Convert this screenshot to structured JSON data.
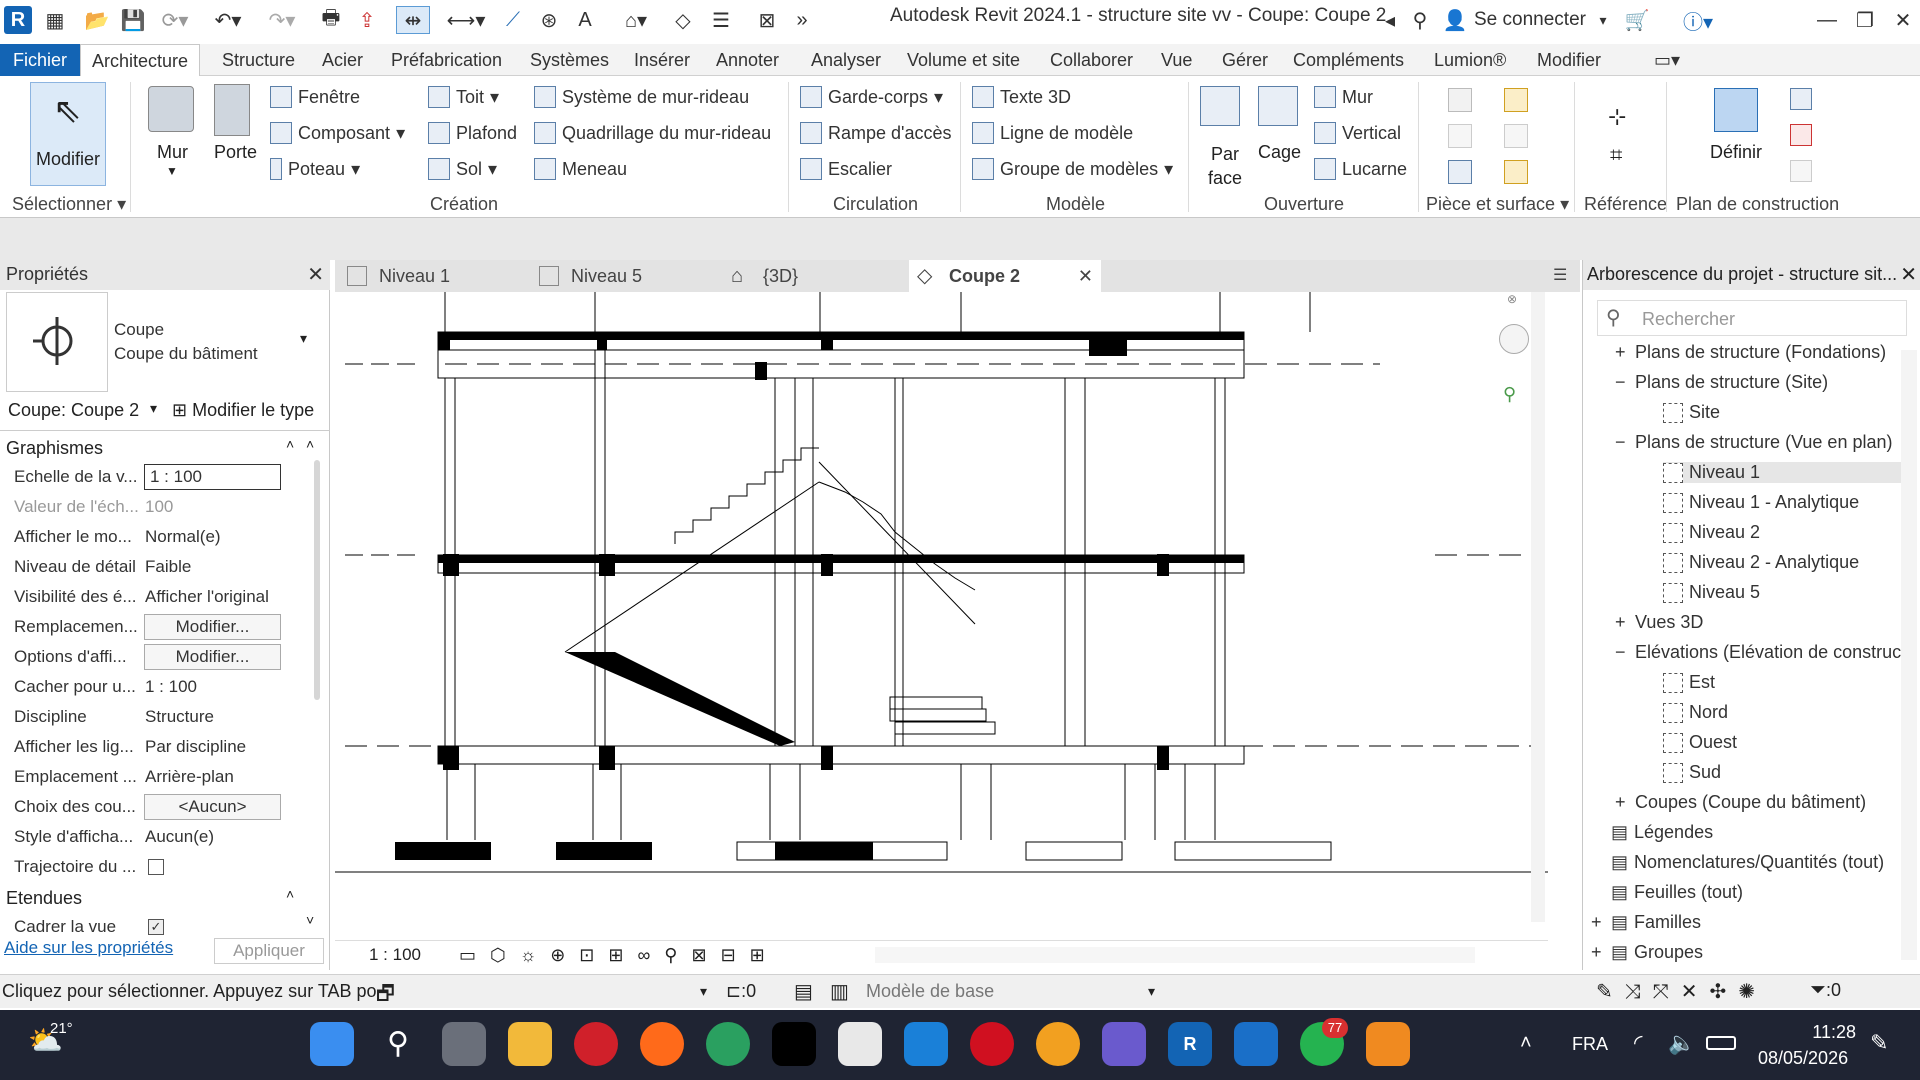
{
  "window": {
    "title": "Autodesk Revit 2024.1 - structure site vv - Coupe: Coupe 2",
    "sign_in": "Se connecter"
  },
  "menu": [
    "Fichier",
    "Architecture",
    "Structure",
    "Acier",
    "Préfabrication",
    "Systèmes",
    "Insérer",
    "Annoter",
    "Analyser",
    "Volume et site",
    "Collaborer",
    "Vue",
    "Gérer",
    "Compléments",
    "Lumion®",
    "Modifier"
  ],
  "ribbon": {
    "modifier": "Modifier",
    "mur": "Mur",
    "porte": "Porte",
    "fenetre": "Fenêtre",
    "composant": "Composant",
    "poteau": "Poteau",
    "toit": "Toit",
    "plafond": "Plafond",
    "sol": "Sol",
    "sys_mur_rideau": "Système de mur-rideau",
    "quad_mur_rideau": "Quadrillage du mur-rideau",
    "meneau": "Meneau",
    "garde_corps": "Garde-corps",
    "rampe": "Rampe d'accès",
    "escalier": "Escalier",
    "texte3d": "Texte 3D",
    "ligne_modele": "Ligne de modèle",
    "groupe_modeles": "Groupe de modèles",
    "par_face_1": "Par",
    "par_face_2": "face",
    "cage": "Cage",
    "mur_ouv": "Mur",
    "vertical": "Vertical",
    "lucarne": "Lucarne",
    "definir": "Définir",
    "groups": {
      "selectionner": "Sélectionner",
      "creation": "Création",
      "circulation": "Circulation",
      "modele": "Modèle",
      "ouverture": "Ouverture",
      "piece_surface": "Pièce et surface",
      "reference": "Référence",
      "plan_construction": "Plan de construction"
    }
  },
  "properties": {
    "header": "Propriétés",
    "type_line1": "Coupe",
    "type_line2": "Coupe du bâtiment",
    "instance_selector": "Coupe: Coupe 2",
    "edit_type": "Modifier le type",
    "section_graphics": "Graphismes",
    "section_extents": "Etendues",
    "rows": [
      {
        "k": "Echelle de la v...",
        "v": "1 : 100"
      },
      {
        "k": "Valeur de l'éch...",
        "v": "100"
      },
      {
        "k": "Afficher le mo...",
        "v": "Normal(e)"
      },
      {
        "k": "Niveau de détail",
        "v": "Faible"
      },
      {
        "k": "Visibilité des é...",
        "v": "Afficher l'original"
      },
      {
        "k": "Remplacemen...",
        "v": "Modifier..."
      },
      {
        "k": "Options d'affi...",
        "v": "Modifier..."
      },
      {
        "k": "Cacher pour u...",
        "v": "1 : 100"
      },
      {
        "k": "Discipline",
        "v": "Structure"
      },
      {
        "k": "Afficher les lig...",
        "v": "Par discipline"
      },
      {
        "k": "Emplacement ...",
        "v": "Arrière-plan"
      },
      {
        "k": "Choix des cou...",
        "v": "<Aucun>"
      },
      {
        "k": "Style d'afficha...",
        "v": "Aucun(e)"
      },
      {
        "k": "Trajectoire du ...",
        "v": ""
      }
    ],
    "crop_view": "Cadrer la vue",
    "help_link": "Aide sur les propriétés",
    "apply": "Appliquer"
  },
  "tabs": [
    {
      "label": "Niveau 1"
    },
    {
      "label": "Niveau 5"
    },
    {
      "label": "{3D}"
    },
    {
      "label": "Coupe 2"
    }
  ],
  "view": {
    "scale": "1 : 100"
  },
  "browser": {
    "header": "Arborescence du projet - structure sit...",
    "search_placeholder": "Rechercher",
    "items": [
      {
        "label": "Plans de structure (Fondations)",
        "lvl": 1,
        "exp": "+"
      },
      {
        "label": "Plans de structure (Site)",
        "lvl": 1,
        "exp": "−"
      },
      {
        "label": "Site",
        "lvl": 2,
        "exp": ""
      },
      {
        "label": "Plans de structure (Vue en plan)",
        "lvl": 1,
        "exp": "−"
      },
      {
        "label": "Niveau 1",
        "lvl": 2,
        "exp": ""
      },
      {
        "label": "Niveau 1 - Analytique",
        "lvl": 2,
        "exp": ""
      },
      {
        "label": "Niveau 2",
        "lvl": 2,
        "exp": ""
      },
      {
        "label": "Niveau 2 - Analytique",
        "lvl": 2,
        "exp": ""
      },
      {
        "label": "Niveau 5",
        "lvl": 2,
        "exp": ""
      },
      {
        "label": "Vues 3D",
        "lvl": 1,
        "exp": "+"
      },
      {
        "label": "Elévations (Elévation de construction)",
        "lvl": 1,
        "exp": "−"
      },
      {
        "label": "Est",
        "lvl": 2,
        "exp": ""
      },
      {
        "label": "Nord",
        "lvl": 2,
        "exp": ""
      },
      {
        "label": "Ouest",
        "lvl": 2,
        "exp": ""
      },
      {
        "label": "Sud",
        "lvl": 2,
        "exp": ""
      },
      {
        "label": "Coupes (Coupe du bâtiment)",
        "lvl": 1,
        "exp": "+"
      },
      {
        "label": "Légendes",
        "lvl": 0,
        "exp": ""
      },
      {
        "label": "Nomenclatures/Quantités (tout)",
        "lvl": 0,
        "exp": ""
      },
      {
        "label": "Feuilles (tout)",
        "lvl": 0,
        "exp": ""
      },
      {
        "label": "Familles",
        "lvl": 0,
        "exp": "+"
      },
      {
        "label": "Groupes",
        "lvl": 0,
        "exp": "+"
      }
    ]
  },
  "status": {
    "message": "Cliquez pour sélectionner. Appuyez sur TAB po",
    "workset_count": ":0",
    "model": "Modèle de base",
    "filter_count": ":0"
  },
  "taskbar": {
    "weather": "21°",
    "lang": "FRA",
    "time": "11:28",
    "date": "08/05/2026",
    "whatsapp_badge": "77"
  },
  "colors": {
    "accent": "#1364b4",
    "taskbar": "#1f2433"
  }
}
